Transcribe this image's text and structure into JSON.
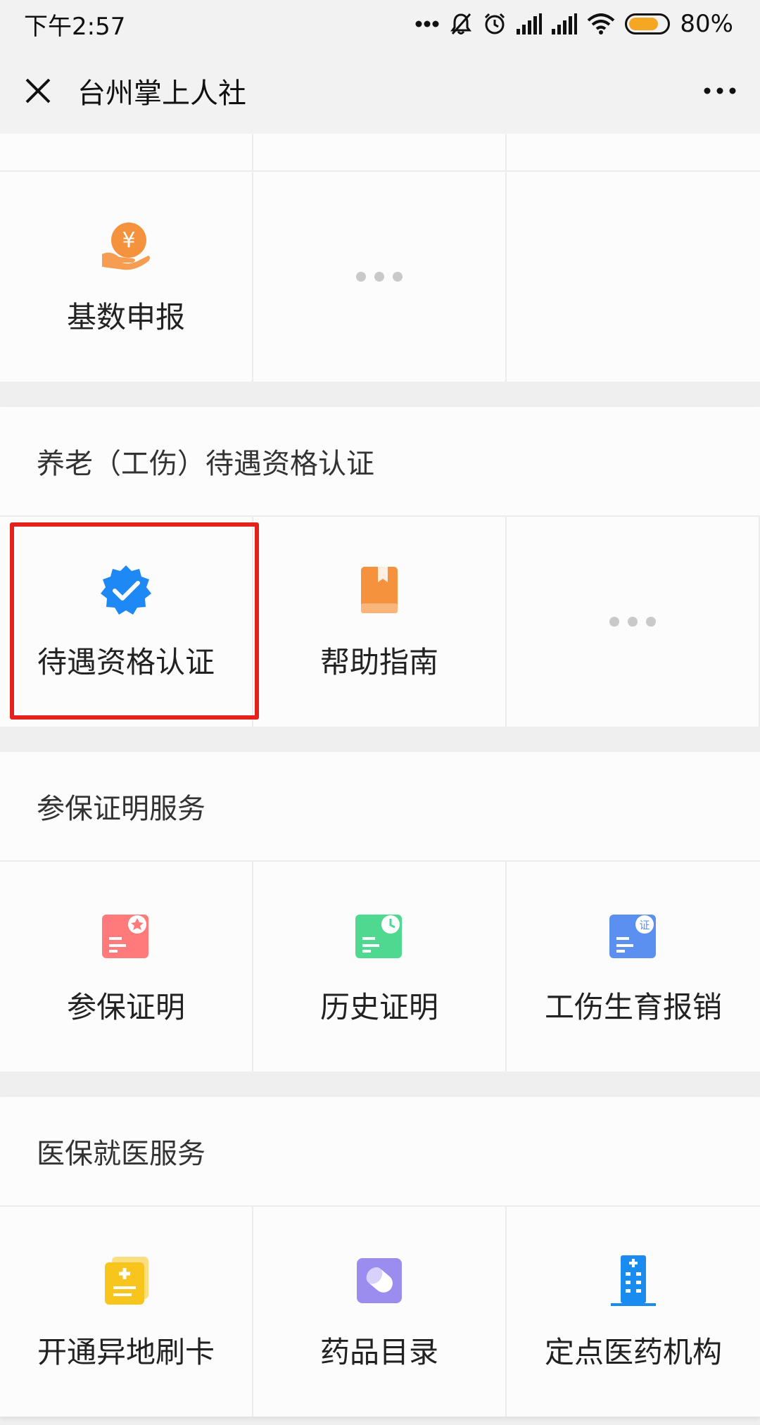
{
  "status_bar": {
    "time": "下午2:57",
    "battery_percent": "80%",
    "battery_level": 0.8
  },
  "nav": {
    "title": "台州掌上人社",
    "close_icon": "close-icon",
    "more_icon": "more-icon"
  },
  "top_grid": {
    "items": [
      {
        "label": "基数申报",
        "icon": "yuan-hand-icon",
        "color": "#f5923e"
      },
      {
        "label": "",
        "icon": "more-dots-icon"
      },
      {
        "label": "",
        "icon": ""
      }
    ]
  },
  "section_pension": {
    "title": "养老（工伤）待遇资格认证",
    "items": [
      {
        "label": "待遇资格认证",
        "icon": "verified-badge-icon",
        "color": "#1e88f5",
        "highlighted": true
      },
      {
        "label": "帮助指南",
        "icon": "book-icon",
        "color": "#f5923e"
      },
      {
        "label": "",
        "icon": "more-dots-icon"
      }
    ]
  },
  "section_insurance_proof": {
    "title": "参保证明服务",
    "items": [
      {
        "label": "参保证明",
        "icon": "certificate-star-icon",
        "color": "#ff7b7b"
      },
      {
        "label": "历史证明",
        "icon": "certificate-clock-icon",
        "color": "#4fd890"
      },
      {
        "label": "工伤生育报销",
        "icon": "certificate-zheng-icon",
        "color": "#5b8ff0"
      }
    ],
    "zheng_glyph": "证"
  },
  "section_medical": {
    "title": "医保就医服务",
    "items": [
      {
        "label": "开通异地刷卡",
        "icon": "medical-card-icon",
        "color": "#f8c51c"
      },
      {
        "label": "药品目录",
        "icon": "pill-icon",
        "color": "#9b8cf0"
      },
      {
        "label": "定点医药机构",
        "icon": "hospital-building-icon",
        "color": "#1a8cf0"
      }
    ]
  }
}
